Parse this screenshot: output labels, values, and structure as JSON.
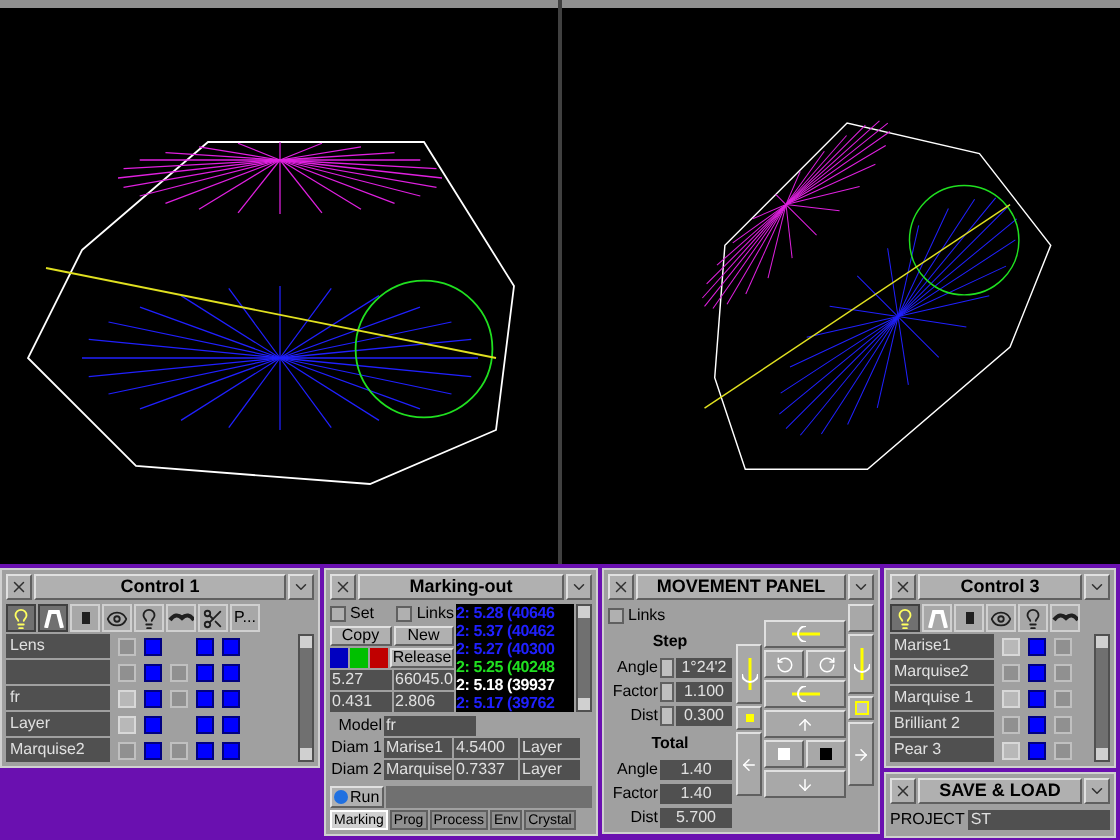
{
  "control1": {
    "title": "Control 1",
    "header": [
      {
        "kind": "bulb",
        "selected": true
      },
      {
        "kind": "arch",
        "selected": true
      },
      {
        "kind": "hash",
        "selected": false
      },
      {
        "kind": "eye",
        "selected": false
      },
      {
        "kind": "bulb2",
        "selected": false
      },
      {
        "kind": "caterpillar",
        "selected": false
      },
      {
        "kind": "scissors",
        "selected": false
      },
      {
        "kind": "text",
        "label": "P...",
        "selected": false
      }
    ],
    "rows": [
      {
        "name": "Lens",
        "cells": [
          {
            "kind": "grey"
          },
          {
            "kind": "blue"
          },
          {
            "kind": "blank"
          },
          {
            "kind": "blue"
          },
          {
            "kind": "blue"
          }
        ]
      },
      {
        "cells": [
          {
            "kind": "grey"
          },
          {
            "kind": "blue"
          },
          {
            "kind": "grey"
          },
          {
            "kind": "blue"
          },
          {
            "kind": "blue"
          }
        ]
      },
      {
        "name": "fr",
        "cells": [
          {
            "kind": "light"
          },
          {
            "kind": "blue"
          },
          {
            "kind": "grey"
          },
          {
            "kind": "blue"
          },
          {
            "kind": "blue"
          }
        ]
      },
      {
        "name": "Layer",
        "cells": [
          {
            "kind": "light"
          },
          {
            "kind": "blue"
          },
          {
            "kind": "blank"
          },
          {
            "kind": "blue"
          },
          {
            "kind": "blue"
          }
        ]
      },
      {
        "name": "Marquise2",
        "cells": [
          {
            "kind": "grey"
          },
          {
            "kind": "blue"
          },
          {
            "kind": "grey"
          },
          {
            "kind": "blue"
          },
          {
            "kind": "blue"
          }
        ]
      }
    ]
  },
  "marking": {
    "title": "Marking-out",
    "set": {
      "label": "Set",
      "checked": false
    },
    "links": {
      "label": "Links",
      "checked": false
    },
    "copy": "Copy",
    "new": "New",
    "swatches": [
      {
        "color": "#0000c0"
      },
      {
        "color": "#00c000"
      },
      {
        "color": "#c00000"
      }
    ],
    "release": "Release",
    "fields": [
      "5.27",
      "66045.0",
      "0.431",
      "2.806"
    ],
    "list": [
      {
        "text": "2: 5.28 (40646",
        "kind": "normal"
      },
      {
        "text": "2: 5.37 (40462",
        "kind": "normal"
      },
      {
        "text": "2: 5.27 (40300",
        "kind": "normal"
      },
      {
        "text": "2: 5.25 (40248",
        "kind": "current"
      },
      {
        "text": "2: 5.18 (39937",
        "kind": "selected"
      },
      {
        "text": "2: 5.17 (39762",
        "kind": "normal"
      }
    ],
    "model": {
      "label": "Model",
      "value": "fr"
    },
    "diams": [
      {
        "label": "Diam 1",
        "name": "Marise1",
        "value": "4.5400",
        "layer": "Layer"
      },
      {
        "label": "Diam 2",
        "name": "Marquise",
        "value": "0.7337",
        "layer": "Layer"
      }
    ],
    "run": "Run",
    "tabs": [
      {
        "label": "Marking",
        "selected": true
      },
      {
        "label": "Prog",
        "selected": false
      },
      {
        "label": "Process",
        "selected": false
      },
      {
        "label": "Env",
        "selected": false
      },
      {
        "label": "Crystal",
        "selected": false
      }
    ]
  },
  "movement": {
    "title": "MOVEMENT PANEL",
    "links": {
      "label": "Links",
      "checked": false
    },
    "step": "Step",
    "step_rows": [
      {
        "label": "Angle",
        "value": "1°24'2"
      },
      {
        "label": "Factor",
        "value": "1.100"
      },
      {
        "label": "Dist",
        "value": "0.300"
      }
    ],
    "total": "Total",
    "total_rows": [
      {
        "label": "Angle",
        "value": "1.40"
      },
      {
        "label": "Factor",
        "value": "1.40"
      },
      {
        "label": "Dist",
        "value": "5.700"
      }
    ]
  },
  "control3": {
    "title": "Control 3",
    "header": [
      {
        "kind": "bulb",
        "selected": true
      },
      {
        "kind": "arch",
        "selected": false
      },
      {
        "kind": "hash",
        "selected": false
      },
      {
        "kind": "eye",
        "selected": false
      },
      {
        "kind": "bulb2",
        "selected": false
      },
      {
        "kind": "caterpillar",
        "selected": false
      }
    ],
    "rows": [
      {
        "name": "Marise1",
        "cells": [
          {
            "kind": "light"
          },
          {
            "kind": "blue"
          },
          {
            "kind": "grey"
          }
        ]
      },
      {
        "name": "Marquise2",
        "cells": [
          {
            "kind": "grey"
          },
          {
            "kind": "blue"
          },
          {
            "kind": "grey"
          }
        ]
      },
      {
        "name": "Marquise 1",
        "cells": [
          {
            "kind": "light"
          },
          {
            "kind": "blue"
          },
          {
            "kind": "grey"
          }
        ]
      },
      {
        "name": "Brilliant 2",
        "cells": [
          {
            "kind": "grey"
          },
          {
            "kind": "blue"
          },
          {
            "kind": "grey"
          }
        ]
      },
      {
        "name": "Pear 3",
        "cells": [
          {
            "kind": "light"
          },
          {
            "kind": "blue"
          },
          {
            "kind": "grey"
          }
        ]
      }
    ]
  },
  "save_load": {
    "title": "SAVE & LOAD",
    "project_label": "PROJECT",
    "project": "ST"
  }
}
